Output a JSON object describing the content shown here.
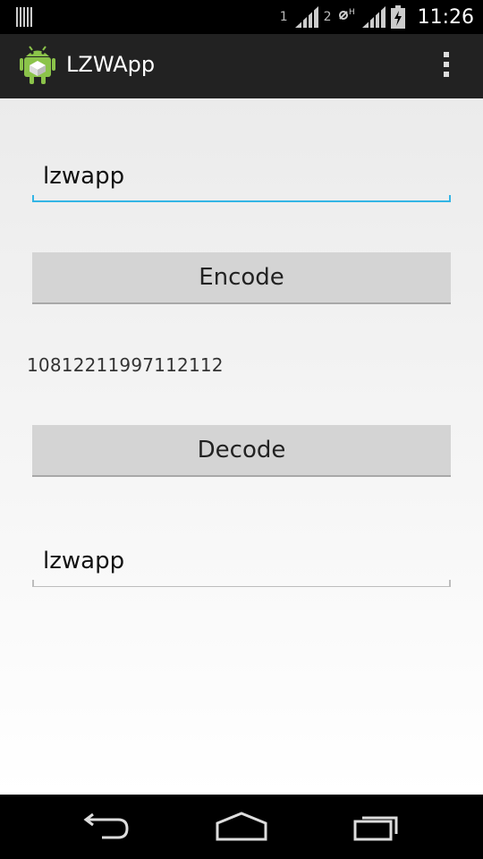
{
  "status_bar": {
    "sim1_label": "1",
    "sim2_label": "2",
    "time": "11:26",
    "icons": [
      "barcode-icon",
      "signal-sim1-icon",
      "data-h-icon",
      "signal-sim2-icon",
      "battery-charging-icon"
    ]
  },
  "action_bar": {
    "title": "LZWApp",
    "icons": [
      "android-app-icon",
      "overflow-menu-icon"
    ]
  },
  "form": {
    "input_value": "lzwapp",
    "encode_label": "Encode",
    "encoded_output": "10812211997112112",
    "decode_label": "Decode",
    "decoded_value": "lzwapp"
  },
  "nav_bar": {
    "icons": [
      "back-icon",
      "home-icon",
      "recents-icon"
    ]
  },
  "colors": {
    "accent": "#33b5e5",
    "action_bar": "#222222",
    "button": "#d4d4d4"
  }
}
